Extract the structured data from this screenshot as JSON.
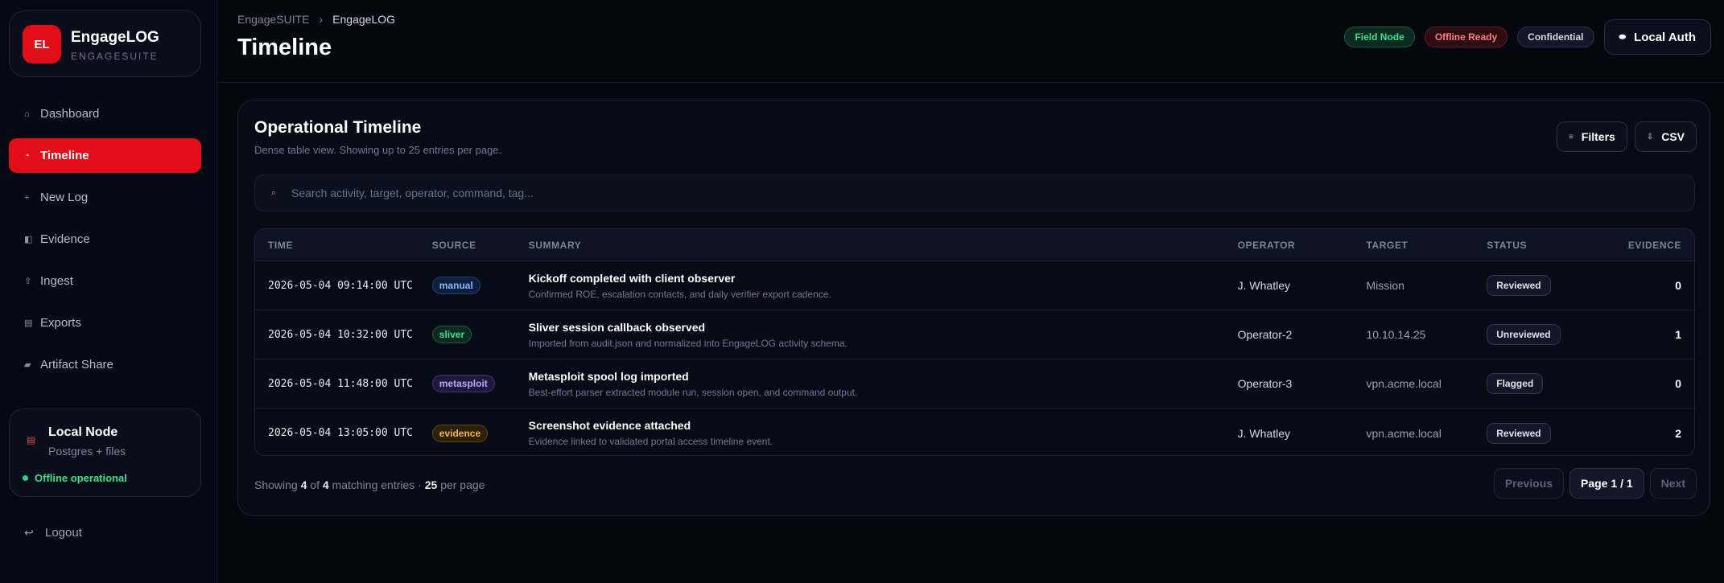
{
  "brand": {
    "logo": "EL",
    "name": "EngageLOG",
    "sub": "ENGAGESUITE"
  },
  "nav": [
    {
      "label": "Dashboard",
      "icon": "home-icon",
      "glyph": "⌂"
    },
    {
      "label": "Timeline",
      "icon": "clock-icon",
      "glyph": "◔"
    },
    {
      "label": "New Log",
      "icon": "plus-icon",
      "glyph": "+"
    },
    {
      "label": "Evidence",
      "icon": "evidence-icon",
      "glyph": "◧"
    },
    {
      "label": "Ingest",
      "icon": "upload-icon",
      "glyph": "⇧"
    },
    {
      "label": "Exports",
      "icon": "export-icon",
      "glyph": "▤"
    },
    {
      "label": "Artifact Share",
      "icon": "share-icon",
      "glyph": "▰"
    }
  ],
  "node": {
    "title": "Local Node",
    "sub": "Postgres + files",
    "status": "Offline operational"
  },
  "logout": "Logout",
  "header": {
    "breadcrumb": [
      "EngageSUITE",
      "EngageLOG"
    ],
    "title": "Timeline",
    "chips": [
      "Field Node",
      "Offline Ready",
      "Confidential"
    ],
    "auth_label": "Local Auth"
  },
  "panel": {
    "title": "Operational Timeline",
    "subtitle": "Dense table view. Showing up to 25 entries per page.",
    "filters_label": "Filters",
    "csv_label": "CSV",
    "search_placeholder": "Search activity, target, operator, command, tag..."
  },
  "table": {
    "columns": [
      "TIME",
      "SOURCE",
      "SUMMARY",
      "OPERATOR",
      "TARGET",
      "STATUS",
      "EVIDENCE"
    ],
    "rows": [
      {
        "time": "2026-05-04 09:14:00 UTC",
        "source": "manual",
        "title": "Kickoff completed with client observer",
        "desc": "Confirmed ROE, escalation contacts, and daily verifier export cadence.",
        "operator": "J. Whatley",
        "target": "Mission",
        "status": "Reviewed",
        "evidence": "0"
      },
      {
        "time": "2026-05-04 10:32:00 UTC",
        "source": "sliver",
        "title": "Sliver session callback observed",
        "desc": "Imported from audit.json and normalized into EngageLOG activity schema.",
        "operator": "Operator-2",
        "target": "10.10.14.25",
        "status": "Unreviewed",
        "evidence": "1"
      },
      {
        "time": "2026-05-04 11:48:00 UTC",
        "source": "metasploit",
        "title": "Metasploit spool log imported",
        "desc": "Best-effort parser extracted module run, session open, and command output.",
        "operator": "Operator-3",
        "target": "vpn.acme.local",
        "status": "Flagged",
        "evidence": "0"
      },
      {
        "time": "2026-05-04 13:05:00 UTC",
        "source": "evidence",
        "title": "Screenshot evidence attached",
        "desc": "Evidence linked to validated portal access timeline event.",
        "operator": "J. Whatley",
        "target": "vpn.acme.local",
        "status": "Reviewed",
        "evidence": "2"
      }
    ]
  },
  "footer": {
    "showing": "Showing",
    "shown": "4",
    "of": "of",
    "total": "4",
    "matching": "matching entries ·",
    "per": "25",
    "per_page": "per page",
    "prev": "Previous",
    "page": "Page 1 / 1",
    "next": "Next"
  },
  "colors": {
    "accent": "#e10d18",
    "success": "#3ee08e",
    "background": "#05070f"
  }
}
